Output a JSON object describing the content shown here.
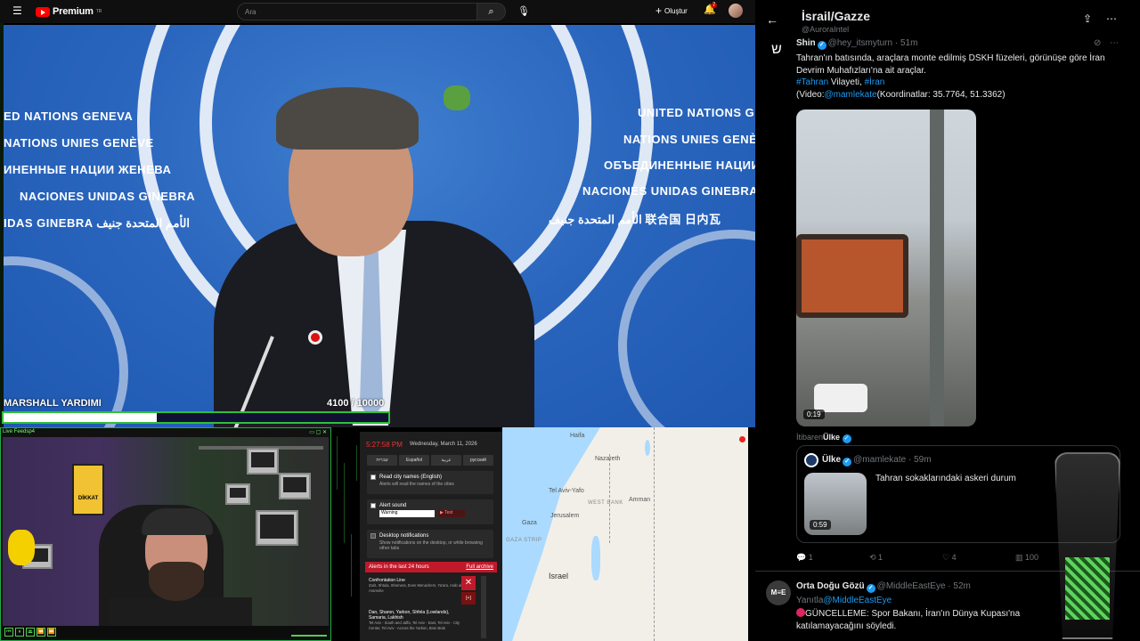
{
  "youtube": {
    "brand": "Premium",
    "brand_super": "TR",
    "search_placeholder": "Ara",
    "create_label": "Oluştur",
    "notif_count": "7",
    "menu_icon": "hamburger-icon"
  },
  "stream": {
    "goal_label": "MARSHALL YARDIMI",
    "goal_count": "4100  / 10000",
    "goal_current": 4100,
    "goal_total": 10000
  },
  "un_backdrop": {
    "left_lines": [
      "ED NATIONS GENEVA",
      "NATIONS UNIES GENÈVE",
      "ИНЕННЫЕ НАЦИИ ЖЕНЕВА",
      "NACIONES UNIDAS GINEBRA",
      "IDAS GINEBRA   الأمم المتحدة جنيف"
    ],
    "right_lines": [
      "UNITED NATIONS GE",
      "NATIONS UNIES GENÈ",
      "ОБЪЕДИНЕННЫЕ НАЦИИ",
      "NACIONES UNIDAS GINEBRA",
      "الأمم المتحدة جنيف  联合国 日内瓦"
    ]
  },
  "webcam": {
    "title": "Live Feedsp4",
    "sign_text": "DİKKAT"
  },
  "alerts": {
    "time": "5:27:58 PM",
    "date": "Wednesday, March 11, 2026",
    "languages": [
      "עברית",
      "Español",
      "عربية",
      "русский"
    ],
    "read_city": {
      "title": "Read city names (English)",
      "desc": "Alerts will read the names of the cities"
    },
    "alert_sound": {
      "title": "Alert sound",
      "selected": "Warning",
      "test": "▶ Test"
    },
    "desktop": {
      "title": "Desktop notifications",
      "desc": "Show notifications on the desktop, or while browsing other tabs"
    },
    "header": "Alerts in the last 24 hours",
    "archive": "Full archive",
    "items": [
      {
        "title": "Confrontation Line",
        "sub": "Zarit, Shtula, Shomera, Even Menachem, Ya'ara, Arab al-Aramshe"
      },
      {
        "title": "Dan, Sharon, Yarkon, Shfela (Lowlands), Samaria, Lakhish",
        "sub": "Tel Aviv - South and Jaffa, Tel Aviv - East, Tel Aviv - City Center, Tel Aviv - Across the Yarkon, Bnei Brak"
      }
    ],
    "close": "✕"
  },
  "map": {
    "labels": [
      "Haifa",
      "Nazareth",
      "Tel Aviv-Yafo",
      "WEST BANK",
      "Amman",
      "Jerusalem",
      "Israel",
      "GAZA STRIP",
      "Gaza"
    ]
  },
  "twitter": {
    "list_title": "İsrail/Gazze",
    "list_handle": "@AuroraIntel",
    "tweet1": {
      "name": "Shin",
      "meta": "@hey_itsmyturn · 51m",
      "text_1": "Tahran'ın batısında, araçlara monte edilmiş DSKH füzeleri, görünüşe göre İran Devrim Muhafızları'na ait araçlar.",
      "tag_1": "#Tahran",
      "text_2": " Vilayeti, ",
      "tag_2": "#İran",
      "text_3": "(Video:",
      "mention": "@mamlekate",
      "text_4": "(Koordinatlar: 35.7764, 51.3362)",
      "duration": "0:19",
      "from_prefix": "İtibaren",
      "from_name": "Ülke"
    },
    "quote": {
      "name": "Ülke",
      "meta": "@mamlekate · 59m",
      "text": "Tahran sokaklarındaki askeri durum",
      "duration": "0:59"
    },
    "actions": {
      "replies": "1",
      "retweets": "1",
      "likes": "4",
      "views": "100"
    },
    "tweet2": {
      "name": "Orta Doğu Gözü",
      "meta": "@MiddleEastEye · 52m",
      "reply_prefix": "Yanıtla",
      "reply_to": "@MiddleEastEye",
      "text": "GÜNCELLEME: Spor Bakanı, İran'ın Dünya Kupası'na katılamayacağını söyledi.",
      "avatar_text": "M≡E"
    }
  }
}
